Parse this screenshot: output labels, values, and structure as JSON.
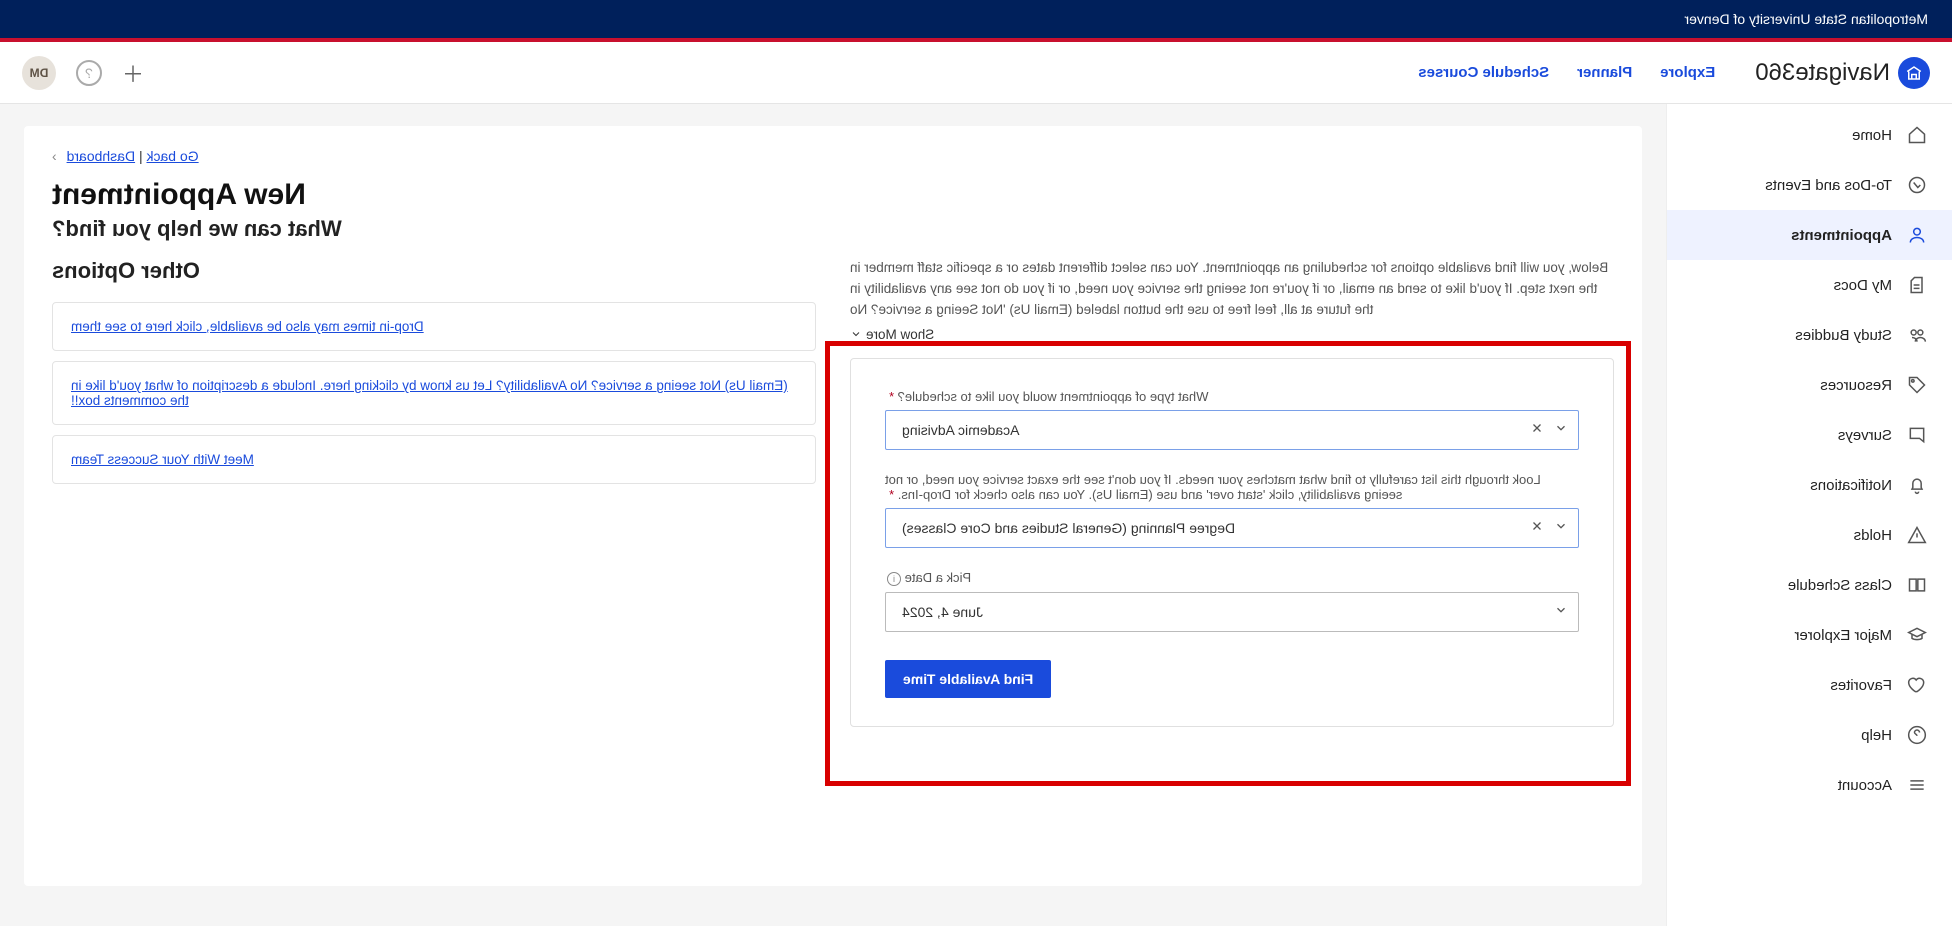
{
  "brand": {
    "university": "Metropolitan State University of Denver"
  },
  "header": {
    "product": "Navigate360",
    "links": {
      "explore": "Explore",
      "planner": "Planner",
      "schedule": "Schedule Courses"
    },
    "avatar_initials": "DM"
  },
  "sidebar": {
    "items": [
      {
        "label": "Home",
        "icon": "home"
      },
      {
        "label": "To-Dos and Events",
        "icon": "check"
      },
      {
        "label": "Appointments",
        "icon": "person"
      },
      {
        "label": "My Docs",
        "icon": "doc"
      },
      {
        "label": "Study Buddies",
        "icon": "people"
      },
      {
        "label": "Resources",
        "icon": "tag"
      },
      {
        "label": "Surveys",
        "icon": "chat"
      },
      {
        "label": "Notifications",
        "icon": "bell"
      },
      {
        "label": "Holds",
        "icon": "warn"
      },
      {
        "label": "Class Schedule",
        "icon": "book"
      },
      {
        "label": "Major Explorer",
        "icon": "cap"
      },
      {
        "label": "Favorites",
        "icon": "heart"
      },
      {
        "label": "Help",
        "icon": "question"
      },
      {
        "label": "Account",
        "icon": "burger"
      }
    ]
  },
  "breadcrumb": {
    "back": "Go back",
    "dashboard": "Dashboard"
  },
  "page": {
    "title": "New Appointment",
    "subtitle": "What can we help you find?",
    "description": "Below, you will find available options for scheduling an appointment. You can select different dates or a specific staff member in the next step. If you'd like to send an email, or if you're not seeing the service you need, or if you do not see any availability in the future at all, feel free to use the button labeled (Email Us) 'Not Seeing a service? No",
    "show_more": "Show More"
  },
  "form": {
    "type_label": "What type of appointment would you like to schedule?",
    "type_value": "Academic Advising",
    "service_label": "Look through this list carefully to find what matches your needs. If you don't see the exact service you need, or not seeing availability, click 'start over' and use (Email Us). You can also check for Drop-Ins.",
    "service_value": "Degree Planning (General Studies and Core Classes)",
    "date_label": "Pick a Date",
    "date_value": "June 4, 2024",
    "submit": "Find Available Time"
  },
  "other": {
    "title": "Other Options",
    "opt1": "Drop-in times may also be available, click here to see them",
    "opt2": "(Email Us) Not seeing a service? No Availability? Let us know by clicking here. Include a description of what you'd like in the comments box!!",
    "opt3": "Meet With Your Success Team"
  }
}
